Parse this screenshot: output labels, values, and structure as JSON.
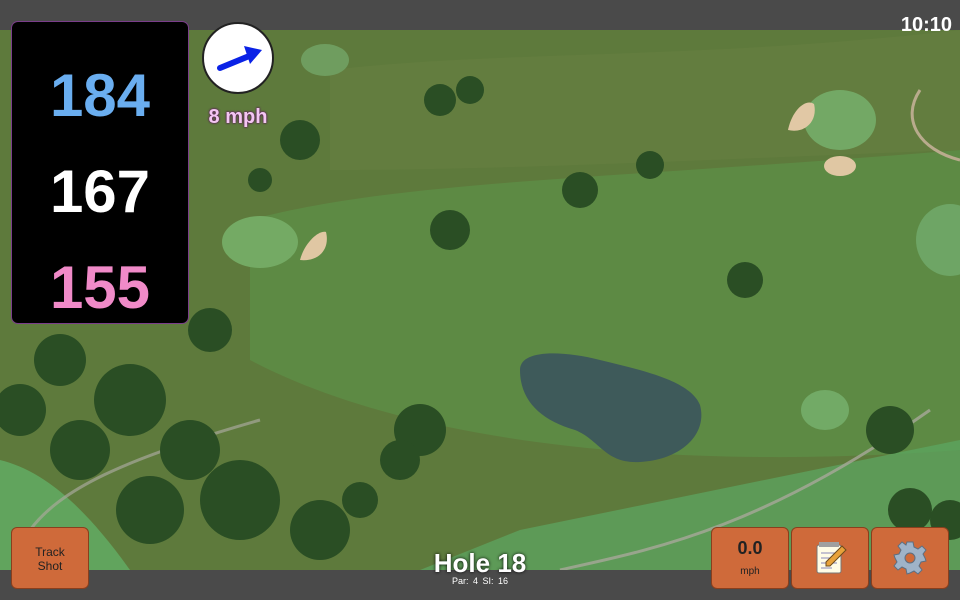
{
  "status": {
    "time": "10:10"
  },
  "distances": {
    "back": "184",
    "middle": "167",
    "front": "155"
  },
  "wind": {
    "speed": "8 mph",
    "direction_icon": "arrow-icon"
  },
  "buttons": {
    "track_shot_line1": "Track",
    "track_shot_line2": "Shot",
    "speed_value": "0.0",
    "speed_unit": "mph",
    "notes_icon": "notepad-icon",
    "settings_icon": "gear-icon"
  },
  "hole": {
    "title": "Hole 18",
    "par_label": "Par: 4",
    "si_label": "SI: 16"
  },
  "colors": {
    "back_distance": "#6aaef0",
    "middle_distance": "#ffffff",
    "front_distance": "#f08ac8",
    "button_fill": "#cf6a3a",
    "wind_arrow": "#0a22e6"
  }
}
